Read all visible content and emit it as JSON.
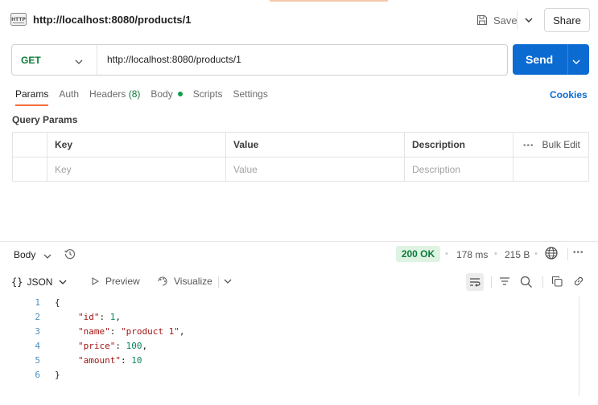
{
  "header": {
    "icon": "http-icon",
    "title": "http://localhost:8080/products/1",
    "save_label": "Save",
    "share_label": "Share"
  },
  "request": {
    "method": "GET",
    "url": "http://localhost:8080/products/1",
    "send_label": "Send"
  },
  "tabs": [
    {
      "label": "Params",
      "active": true
    },
    {
      "label": "Auth"
    },
    {
      "label": "Headers",
      "count": "(8)"
    },
    {
      "label": "Body"
    },
    {
      "label": "Scripts"
    },
    {
      "label": "Settings"
    }
  ],
  "cookies_label": "Cookies",
  "query_params": {
    "title": "Query Params",
    "columns": [
      "Key",
      "Value",
      "Description"
    ],
    "bulk_edit_label": "Bulk Edit",
    "placeholders": [
      "Key",
      "Value",
      "Description"
    ]
  },
  "response": {
    "title": "Body",
    "status": "200 OK",
    "time": "178 ms",
    "size": "215 B",
    "format": "JSON",
    "preview_label": "Preview",
    "visualize_label": "Visualize",
    "lines": [
      {
        "n": "1",
        "text": "{"
      },
      {
        "n": "2",
        "key": "\"id\"",
        "val": "1",
        "type": "num",
        "comma": true
      },
      {
        "n": "3",
        "key": "\"name\"",
        "val": "\"product 1\"",
        "type": "str",
        "comma": true
      },
      {
        "n": "4",
        "key": "\"price\"",
        "val": "100",
        "type": "num",
        "comma": true
      },
      {
        "n": "5",
        "key": "\"amount\"",
        "val": "10",
        "type": "num",
        "comma": false
      },
      {
        "n": "6",
        "text": "}"
      }
    ]
  },
  "colors": {
    "accent": "#f26b3a",
    "primary": "#0b6bd1",
    "method_get": "#0e7a3a",
    "status_ok_bg": "#dff3e3"
  }
}
